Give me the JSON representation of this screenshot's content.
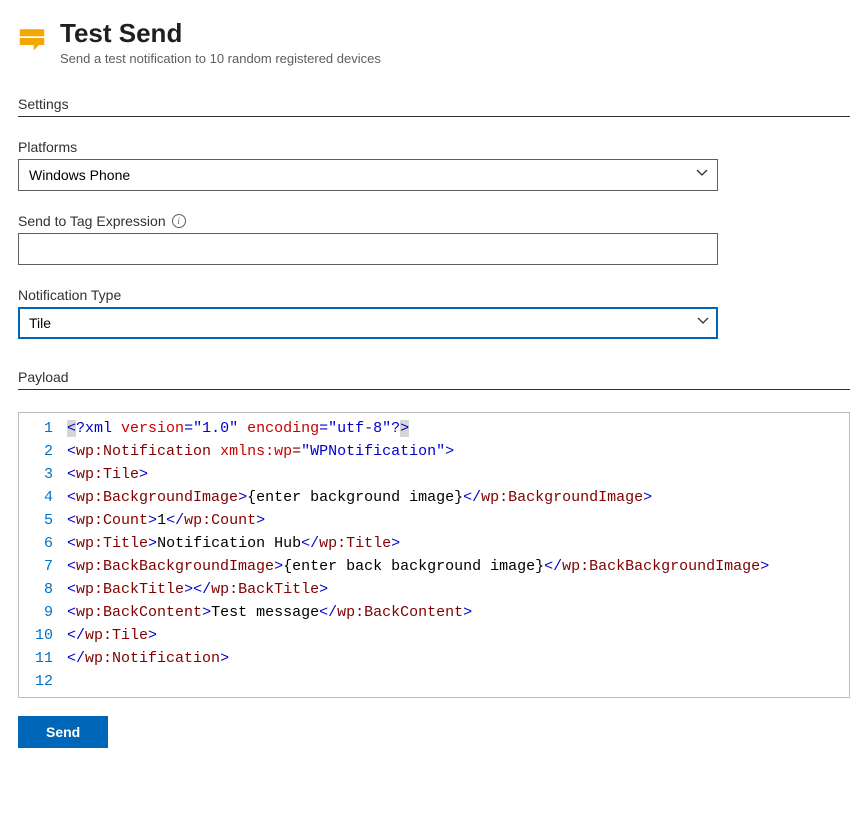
{
  "header": {
    "title": "Test Send",
    "subtitle": "Send a test notification to 10 random registered devices"
  },
  "sections": {
    "settings": "Settings",
    "payload": "Payload"
  },
  "fields": {
    "platforms": {
      "label": "Platforms",
      "value": "Windows Phone"
    },
    "tag_expression": {
      "label": "Send to Tag Expression",
      "value": ""
    },
    "notification_type": {
      "label": "Notification Type",
      "value": "Tile"
    }
  },
  "payload": {
    "lines": [
      [
        {
          "cls": "hl-sel t-brkt",
          "txt": "<"
        },
        {
          "cls": "t-decl",
          "txt": "?xml "
        },
        {
          "cls": "t-attr",
          "txt": "version"
        },
        {
          "cls": "t-decl",
          "txt": "="
        },
        {
          "cls": "t-str",
          "txt": "\"1.0\""
        },
        {
          "cls": "t-decl",
          "txt": " "
        },
        {
          "cls": "t-attr",
          "txt": "encoding"
        },
        {
          "cls": "t-decl",
          "txt": "="
        },
        {
          "cls": "t-str",
          "txt": "\"utf-8\""
        },
        {
          "cls": "t-decl",
          "txt": "?"
        },
        {
          "cls": "hl-sel t-brkt",
          "txt": ">"
        }
      ],
      [
        {
          "cls": "t-brkt",
          "txt": "<"
        },
        {
          "cls": "t-tag",
          "txt": "wp:Notification "
        },
        {
          "cls": "t-attr",
          "txt": "xmlns:wp"
        },
        {
          "cls": "t-tag",
          "txt": "="
        },
        {
          "cls": "t-str",
          "txt": "\"WPNotification\""
        },
        {
          "cls": "t-brkt",
          "txt": ">"
        }
      ],
      [
        {
          "cls": "t-brkt",
          "txt": "<"
        },
        {
          "cls": "t-tag",
          "txt": "wp:Tile"
        },
        {
          "cls": "t-brkt",
          "txt": ">"
        }
      ],
      [
        {
          "cls": "t-brkt",
          "txt": "<"
        },
        {
          "cls": "t-tag",
          "txt": "wp:BackgroundImage"
        },
        {
          "cls": "t-brkt",
          "txt": ">"
        },
        {
          "cls": "t-text",
          "txt": "{enter background image}"
        },
        {
          "cls": "t-brkt",
          "txt": "</"
        },
        {
          "cls": "t-tag",
          "txt": "wp:BackgroundImage"
        },
        {
          "cls": "t-brkt",
          "txt": ">"
        }
      ],
      [
        {
          "cls": "t-brkt",
          "txt": "<"
        },
        {
          "cls": "t-tag",
          "txt": "wp:Count"
        },
        {
          "cls": "t-brkt",
          "txt": ">"
        },
        {
          "cls": "t-text",
          "txt": "1"
        },
        {
          "cls": "t-brkt",
          "txt": "</"
        },
        {
          "cls": "t-tag",
          "txt": "wp:Count"
        },
        {
          "cls": "t-brkt",
          "txt": ">"
        }
      ],
      [
        {
          "cls": "t-brkt",
          "txt": "<"
        },
        {
          "cls": "t-tag",
          "txt": "wp:Title"
        },
        {
          "cls": "t-brkt",
          "txt": ">"
        },
        {
          "cls": "t-text",
          "txt": "Notification Hub"
        },
        {
          "cls": "t-brkt",
          "txt": "</"
        },
        {
          "cls": "t-tag",
          "txt": "wp:Title"
        },
        {
          "cls": "t-brkt",
          "txt": ">"
        }
      ],
      [
        {
          "cls": "t-brkt",
          "txt": "<"
        },
        {
          "cls": "t-tag",
          "txt": "wp:BackBackgroundImage"
        },
        {
          "cls": "t-brkt",
          "txt": ">"
        },
        {
          "cls": "t-text",
          "txt": "{enter back background image}"
        },
        {
          "cls": "t-brkt",
          "txt": "</"
        },
        {
          "cls": "t-tag",
          "txt": "wp:BackBackgroundImage"
        },
        {
          "cls": "t-brkt",
          "txt": ">"
        }
      ],
      [
        {
          "cls": "t-brkt",
          "txt": "<"
        },
        {
          "cls": "t-tag",
          "txt": "wp:BackTitle"
        },
        {
          "cls": "t-brkt",
          "txt": ">"
        },
        {
          "cls": "t-brkt",
          "txt": "</"
        },
        {
          "cls": "t-tag",
          "txt": "wp:BackTitle"
        },
        {
          "cls": "t-brkt",
          "txt": ">"
        }
      ],
      [
        {
          "cls": "t-brkt",
          "txt": "<"
        },
        {
          "cls": "t-tag",
          "txt": "wp:BackContent"
        },
        {
          "cls": "t-brkt",
          "txt": ">"
        },
        {
          "cls": "t-text",
          "txt": "Test message"
        },
        {
          "cls": "t-brkt",
          "txt": "</"
        },
        {
          "cls": "t-tag",
          "txt": "wp:BackContent"
        },
        {
          "cls": "t-brkt",
          "txt": ">"
        }
      ],
      [
        {
          "cls": "t-brkt",
          "txt": "</"
        },
        {
          "cls": "t-tag",
          "txt": "wp:Tile"
        },
        {
          "cls": "t-brkt",
          "txt": ">"
        }
      ],
      [
        {
          "cls": "t-brkt",
          "txt": "</"
        },
        {
          "cls": "t-tag",
          "txt": "wp:Notification"
        },
        {
          "cls": "t-brkt",
          "txt": ">"
        }
      ],
      []
    ]
  },
  "actions": {
    "send": "Send"
  }
}
